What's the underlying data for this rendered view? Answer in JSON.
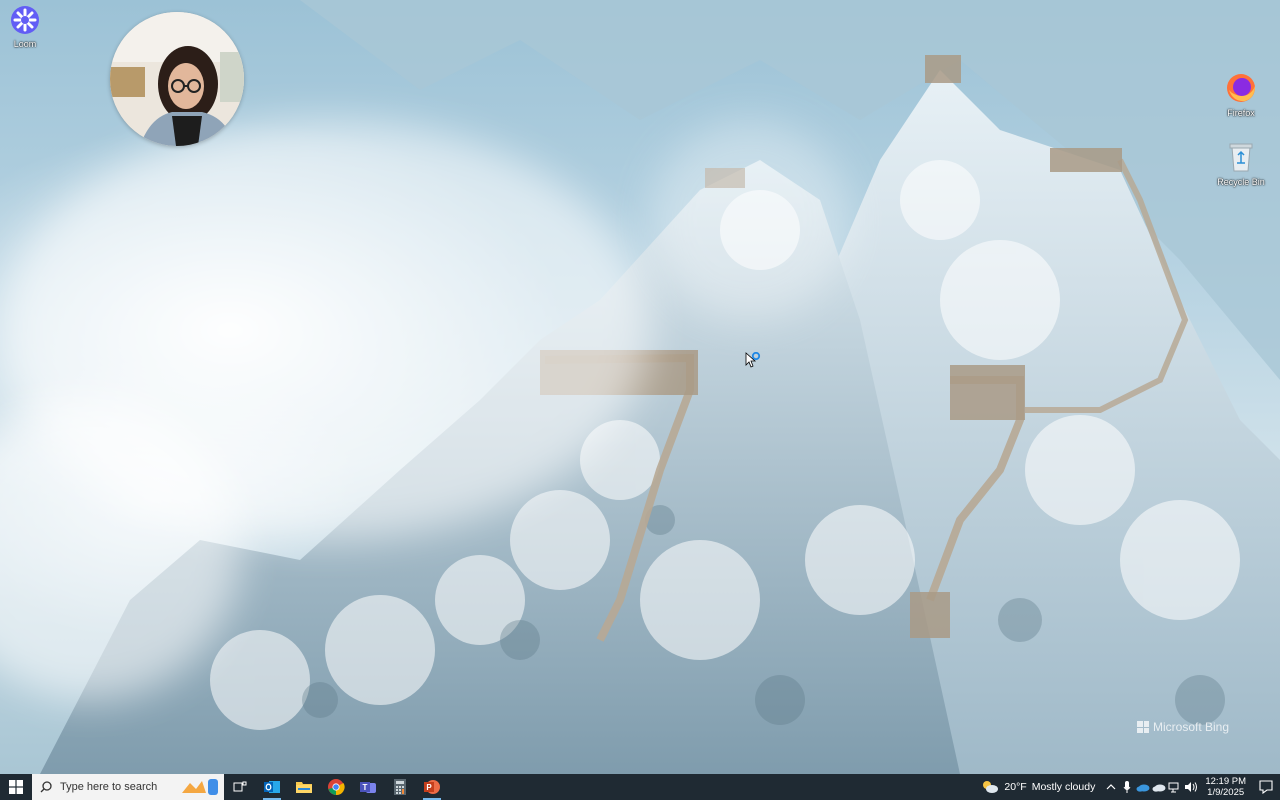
{
  "desktop": {
    "icons": [
      {
        "label": "Loom",
        "icon": "loom-icon"
      },
      {
        "label": "Firefox",
        "icon": "firefox-icon"
      },
      {
        "label": "Recycle Bin",
        "icon": "recycle-bin-icon"
      }
    ],
    "watermark": "Microsoft Bing"
  },
  "taskbar": {
    "search_placeholder": "Type here to search",
    "apps": [
      {
        "name": "Task View",
        "icon": "task-view-icon"
      },
      {
        "name": "Outlook",
        "icon": "outlook-icon",
        "active": true
      },
      {
        "name": "File Explorer",
        "icon": "file-explorer-icon"
      },
      {
        "name": "Google Chrome",
        "icon": "chrome-icon"
      },
      {
        "name": "Microsoft Teams",
        "icon": "teams-icon"
      },
      {
        "name": "Calculator",
        "icon": "calculator-icon"
      },
      {
        "name": "PowerPoint",
        "icon": "powerpoint-icon"
      }
    ],
    "weather": {
      "temp": "20°F",
      "condition": "Mostly cloudy"
    },
    "clock": {
      "time": "12:19 PM",
      "date": "1/9/2025"
    }
  },
  "colors": {
    "taskbar_bg": "#1f2a33",
    "accent": "#76b9ed",
    "search_bg": "#f3f3f3"
  }
}
